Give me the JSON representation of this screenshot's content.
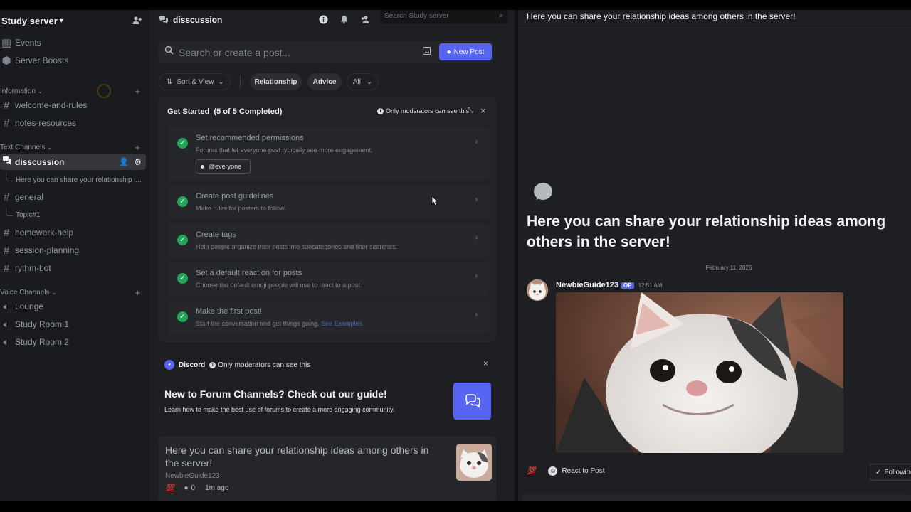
{
  "sidebar": {
    "server_name": "Study server",
    "top_items": [
      {
        "label": "Events",
        "icon": "calendar-icon"
      },
      {
        "label": "Server Boosts",
        "icon": "boost-icon"
      }
    ],
    "categories": {
      "information": "Information",
      "text": "Text Channels",
      "voice": "Voice Channels"
    },
    "info_channels": [
      "welcome-and-rules",
      "notes-resources"
    ],
    "text_channels": {
      "active": "disscussion",
      "active_thread": "Here you can share your relationship i...",
      "general": "general",
      "general_thread": "Topic#1",
      "others": [
        "homework-help",
        "session-planning",
        "rythm-bot"
      ]
    },
    "voice_channels": [
      "Lounge",
      "Study Room 1",
      "Study Room 2"
    ]
  },
  "forum": {
    "channel_name": "disscussion",
    "server_search_placeholder": "Search Study server",
    "search_placeholder": "Search or create a post...",
    "new_post_label": "New Post",
    "sort_label": "Sort & View",
    "tags": [
      "Relationship",
      "Advice"
    ],
    "all_label": "All",
    "get_started": {
      "title": "Get Started",
      "progress": "(5 of 5 Completed)",
      "mod_note": "Only moderators can see this",
      "steps": [
        {
          "title": "Set recommended permissions",
          "desc": "Forums that let everyone post typically see more engagement.",
          "chip": "@everyone"
        },
        {
          "title": "Create post guidelines",
          "desc": "Make rules for posters to follow."
        },
        {
          "title": "Create tags",
          "desc": "Help people organize their posts into subcategories and filter searches."
        },
        {
          "title": "Set a default reaction for posts",
          "desc": "Choose the default emoji people will use to react to a post."
        },
        {
          "title": "Make the first post!",
          "desc": "Start the conversation and get things going.",
          "link": "See Examples"
        }
      ]
    },
    "guide": {
      "brand": "Discord",
      "mod_note": "Only moderators can see this",
      "title": "New to Forum Channels? Check out our guide!",
      "desc": "Learn how to make the best use of forums to create a more engaging community."
    },
    "post": {
      "title": "Here you can share your relationship ideas among others in the server!",
      "author": "NewbieGuide123",
      "reaction": "💯",
      "comments": "0",
      "age": "1m ago"
    }
  },
  "thread": {
    "header": "Here you can share your relationship ideas among others in the server!",
    "title": "Here you can share your relationship ideas among others in the server!",
    "date": "February 11, 2026",
    "author": "NewbieGuide123",
    "op_badge": "OP",
    "time": "12:51 AM",
    "reaction": "💯",
    "react_label": "React to Post",
    "follow_label": "Following"
  }
}
